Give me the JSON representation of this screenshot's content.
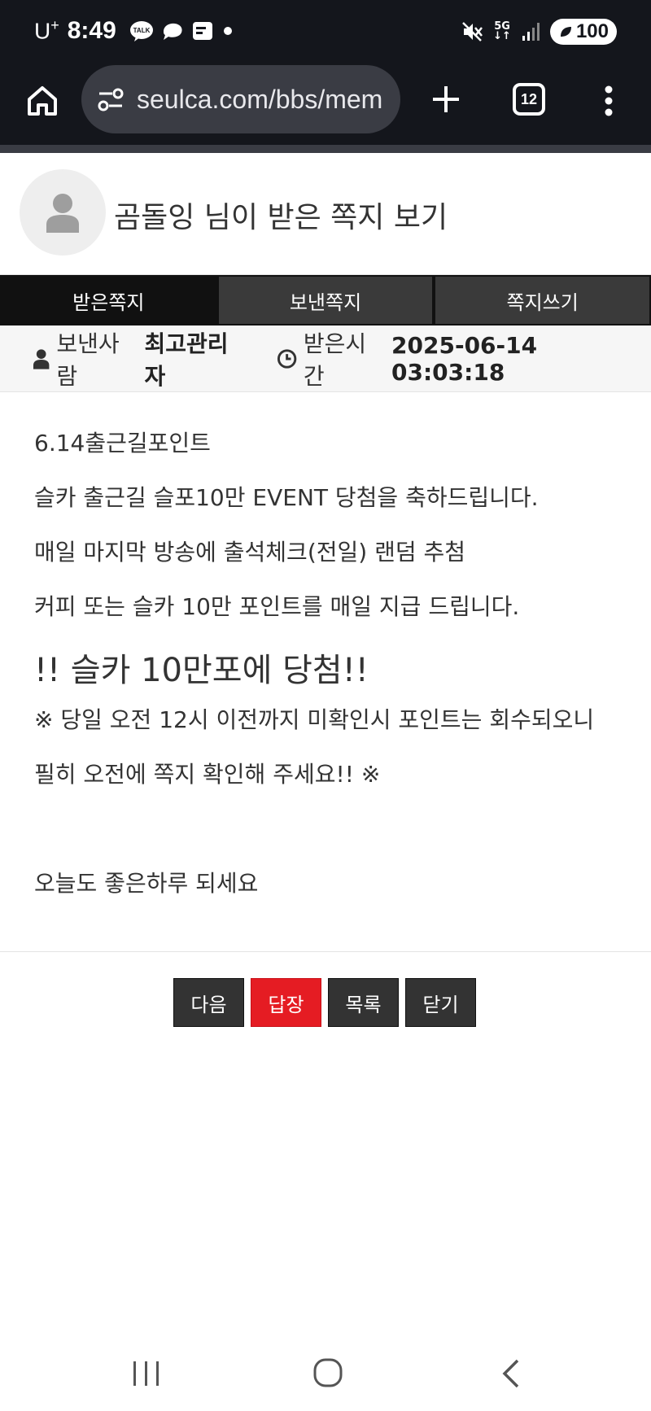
{
  "status_bar": {
    "carrier": "U",
    "carrier_sup": "+",
    "time": "8:49",
    "talk_icon_label": "TALK",
    "network": "5G",
    "battery": "100"
  },
  "browser": {
    "url": "seulca.com/bbs/mem",
    "tab_count": "12"
  },
  "header": {
    "title": "곰돌잉 님이 받은 쪽지 보기"
  },
  "tabs": [
    {
      "label": "받은쪽지",
      "active": true
    },
    {
      "label": "보낸쪽지",
      "active": false
    },
    {
      "label": "쪽지쓰기",
      "active": false
    }
  ],
  "meta": {
    "sender_label": "보낸사람",
    "sender_value": "최고관리자",
    "time_label": "받은시간",
    "time_value": "2025-06-14 03:03:18"
  },
  "message": {
    "lines": [
      "6.14출근길포인트",
      "슬카 출근길 슬포10만 EVENT 당첨을 축하드립니다.",
      "매일 마지막 방송에 출석체크(전일) 랜덤 추첨",
      "커피 또는 슬카 10만 포인트를 매일 지급 드립니다.",
      "!! 슬카 10만포에 당첨!!",
      "※ 당일 오전 12시 이전까지 미확인시 포인트는 회수되오니",
      "필히 오전에 쪽지 확인해 주세요!! ※",
      "",
      "오늘도 좋은하루 되세요"
    ]
  },
  "actions": {
    "next": "다음",
    "reply": "답장",
    "list": "목록",
    "close": "닫기"
  },
  "colors": {
    "status_bg": "#14161c",
    "reply_button": "#e51c23",
    "dark_button": "#333333",
    "active_tab": "#111111"
  }
}
